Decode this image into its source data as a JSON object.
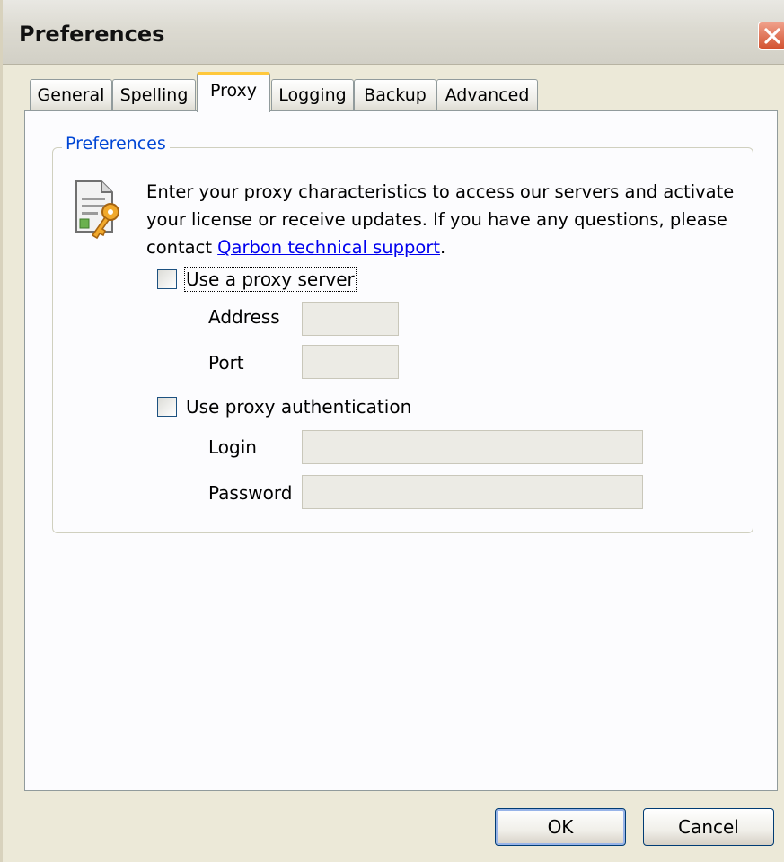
{
  "window": {
    "title": "Preferences"
  },
  "tabs": [
    {
      "label": "General"
    },
    {
      "label": "Spelling"
    },
    {
      "label": "Proxy"
    },
    {
      "label": "Logging"
    },
    {
      "label": "Backup"
    },
    {
      "label": "Advanced"
    }
  ],
  "active_tab": "Proxy",
  "group": {
    "legend": "Preferences",
    "description": "Enter your proxy characteristics to access our servers and activate your license or receive updates. If you have any questions, please contact ",
    "link_text": "Qarbon technical support",
    "description_end": "."
  },
  "proxy": {
    "use_proxy_label": "Use a proxy server",
    "use_proxy_checked": false,
    "address_label": "Address",
    "address_value": "",
    "port_label": "Port",
    "port_value": ""
  },
  "auth": {
    "use_auth_label": "Use proxy authentication",
    "use_auth_checked": false,
    "login_label": "Login",
    "login_value": "",
    "password_label": "Password",
    "password_value": ""
  },
  "buttons": {
    "ok": "OK",
    "cancel": "Cancel"
  },
  "colors": {
    "accent": "#0046d5",
    "tab_highlight": "#ffc83c",
    "close_button": "#d2502e"
  },
  "icons": {
    "close": "close-icon",
    "document_key": "document-key-icon"
  }
}
